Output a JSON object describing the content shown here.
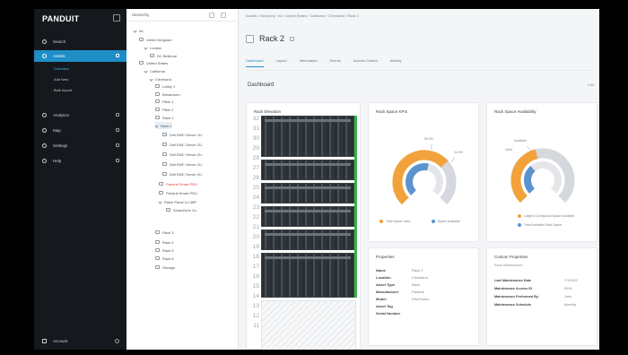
{
  "app": {
    "logo": "PANDUIT"
  },
  "sidebar": {
    "items": [
      {
        "label": "Search"
      },
      {
        "label": "Assets"
      },
      {
        "label": "Analytics"
      },
      {
        "label": "Map"
      },
      {
        "label": "Settings"
      },
      {
        "label": "Help"
      }
    ],
    "sub_items": [
      {
        "label": "Overview"
      },
      {
        "label": "Add New"
      },
      {
        "label": "Bulk Import"
      }
    ],
    "account": "Account"
  },
  "tree": {
    "title": "Hierarchy",
    "nodes": [
      {
        "label": "All"
      },
      {
        "label": "United Kingdom"
      },
      {
        "label": "London"
      },
      {
        "label": "DC Bellevue"
      },
      {
        "label": "United States"
      },
      {
        "label": "California"
      },
      {
        "label": "Cleveland"
      },
      {
        "label": "Lobby 1"
      },
      {
        "label": "Breakroom"
      },
      {
        "label": "Pillar 1"
      },
      {
        "label": "Pillar 2"
      },
      {
        "label": "Rack 1"
      },
      {
        "label": "Rack 2"
      },
      {
        "label": "Dell EMC Server 1U"
      },
      {
        "label": "Dell EMC Server 2U"
      },
      {
        "label": "Dell EMC Server 2U"
      },
      {
        "label": "Dell EMC Server 2U"
      },
      {
        "label": "Dell EMC Server 2U"
      },
      {
        "label": "Panduit Smart PDU"
      },
      {
        "label": "Panduit Smart PDU"
      },
      {
        "label": "Patch Panel 1U 48P"
      },
      {
        "label": "SmartZone 1U"
      },
      {
        "label": "Rack 3"
      },
      {
        "label": "Rack 4"
      },
      {
        "label": "Rack 5"
      },
      {
        "label": "Rack 6"
      },
      {
        "label": "Storage"
      }
    ]
  },
  "main": {
    "breadcrumb": "Assets › Hierarchy › All › United States › California › Cleveland › Rack 2",
    "title": "Rack 2",
    "tabs": [
      {
        "label": "Dashboard"
      },
      {
        "label": "Layout"
      },
      {
        "label": "Information"
      },
      {
        "label": "Events"
      },
      {
        "label": "Access Control"
      },
      {
        "label": "Activity"
      }
    ],
    "section_title": "Dashboard",
    "edit_label": "Edit"
  },
  "elevation": {
    "title": "Rack Elevation",
    "unit_numbers": [
      "32",
      "31",
      "30",
      "29",
      "28",
      "27",
      "26",
      "25",
      "24",
      "23",
      "22",
      "21",
      "20",
      "19",
      "18",
      "17",
      "16",
      "15",
      "14",
      "13",
      "12",
      "11"
    ]
  },
  "kpis": {
    "title": "Rack Space KPIs",
    "legend": [
      {
        "label": "Total Space Used",
        "color": "#f2a23a"
      },
      {
        "label": "Space Available",
        "color": "#5a94cf"
      }
    ],
    "callouts": [
      {
        "label": "56.0%"
      },
      {
        "label": "44.0%"
      }
    ],
    "outer_fraction": 0.68,
    "inner_fraction": 0.55
  },
  "availability": {
    "title": "Rack Space Availability",
    "callouts": [
      {
        "label": "Available"
      },
      {
        "label": "Used"
      }
    ],
    "legend": [
      {
        "label": "Largest Contiguous Space Available",
        "color": "#f2a23a"
      },
      {
        "label": "Total Available Rack Space",
        "color": "#5a94cf"
      }
    ],
    "outer_fraction": 0.45,
    "inner_fraction": 0.35
  },
  "properties": {
    "title": "Properties",
    "rows": [
      {
        "key": "Name",
        "value": "Rack 2"
      },
      {
        "key": "Location",
        "value": "Cleveland"
      },
      {
        "key": "Asset Type",
        "value": "Rack"
      },
      {
        "key": "Manufacturer",
        "value": "Panduit"
      },
      {
        "key": "Model",
        "value": "FlexFusion"
      },
      {
        "key": "Asset Tag",
        "value": ""
      },
      {
        "key": "Serial Number",
        "value": ""
      }
    ]
  },
  "custom_properties": {
    "title": "Custom Properties",
    "subtitle": "Rack Maintenance",
    "rows": [
      {
        "key": "Last Maintenance Date",
        "value": "7/1/2022"
      },
      {
        "key": "Maintenance Access ID",
        "value": "2024"
      },
      {
        "key": "Maintenance Performed By",
        "value": "John"
      },
      {
        "key": "Maintenance Schedule",
        "value": "Monthly"
      }
    ]
  }
}
